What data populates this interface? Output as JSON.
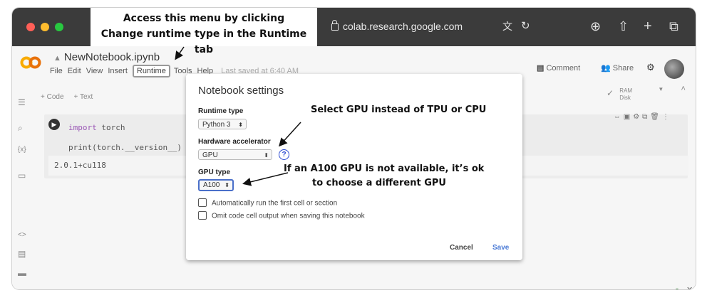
{
  "browser": {
    "url": "colab.research.google.com",
    "icons": [
      "translate-icon",
      "reload-icon",
      "download-icon",
      "share-icon",
      "new-tab-icon",
      "tabs-icon"
    ]
  },
  "annotations": {
    "menu_hint_line1": "Access this menu by clicking",
    "menu_hint_line2": "Change runtime type in the Runtime tab",
    "gpu_hint": "Select GPU instead of TPU or CPU",
    "a100_hint_line1": "If an A100 GPU is not available, it’s ok",
    "a100_hint_line2": "to choose a different GPU"
  },
  "colab": {
    "notebook_title": "NewNotebook.ipynb",
    "menu": {
      "file": "File",
      "edit": "Edit",
      "view": "View",
      "insert": "Insert",
      "runtime": "Runtime",
      "tools": "Tools",
      "help": "Help",
      "last_saved": "Last saved at 6:40 AM"
    },
    "comment_label": "Comment",
    "share_label": "Share",
    "toolbar": {
      "add_code": "+ Code",
      "add_text": "+ Text"
    },
    "ram_label": "RAM",
    "disk_label": "Disk",
    "cell": {
      "line1_keyword": "import",
      "line1_rest": " torch",
      "line2": "print(torch.__version__)",
      "output": "2.0.1+cu118"
    }
  },
  "modal": {
    "title": "Notebook settings",
    "runtime_type_label": "Runtime type",
    "runtime_type_value": "Python 3",
    "hardware_label": "Hardware accelerator",
    "hardware_value": "GPU",
    "gpu_type_label": "GPU type",
    "gpu_type_value": "A100",
    "checkbox1": "Automatically run the first cell or section",
    "checkbox2": "Omit code cell output when saving this notebook",
    "cancel": "Cancel",
    "save": "Save",
    "help_glyph": "?"
  },
  "colors": {
    "accent_blue": "#2b4ad1",
    "save_blue": "#4a7ad6",
    "chrome_dark": "#3b3b3b"
  }
}
